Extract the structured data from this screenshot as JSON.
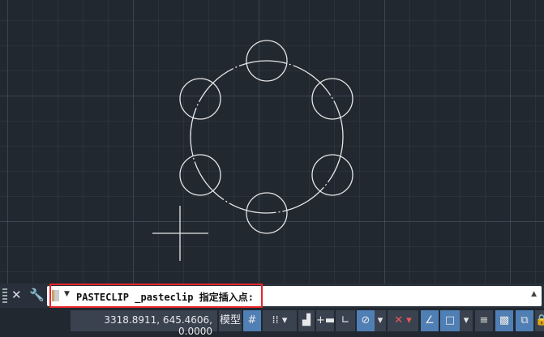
{
  "command_line": {
    "text": "PASTECLIP _pasteclip 指定插入点:"
  },
  "status_bar": {
    "coordinates": "3318.8911, 645.4606, 0.0000",
    "model_label": "模型"
  },
  "colors": {
    "highlight_box": "#e8262b",
    "active_toggle": "#4f7fb4",
    "canvas": "#212830"
  }
}
